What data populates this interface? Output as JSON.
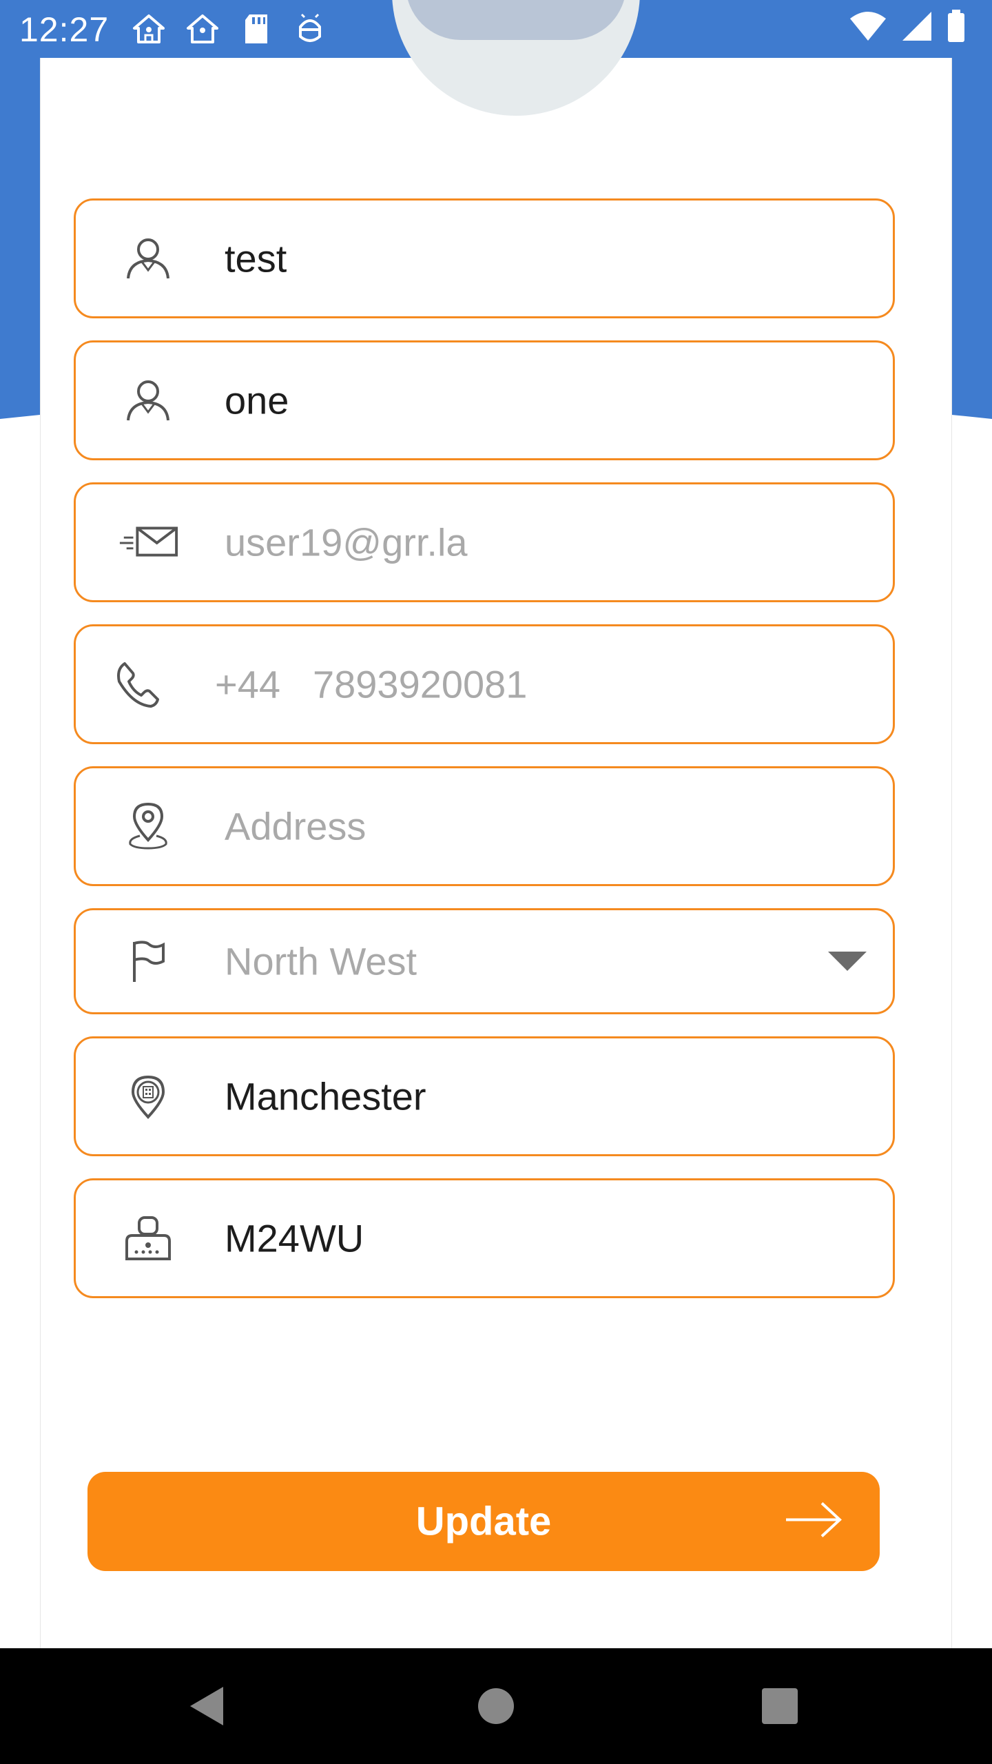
{
  "status_bar": {
    "time": "12:27",
    "left_icons": [
      "home-person-icon",
      "home-icon",
      "sd-card-icon",
      "android-debug-icon"
    ],
    "right_icons": [
      "wifi-icon",
      "cell-signal-icon",
      "battery-icon"
    ]
  },
  "form": {
    "first_name": {
      "value": "test",
      "icon": "person-icon"
    },
    "last_name": {
      "value": "one",
      "icon": "person-icon"
    },
    "email": {
      "value": "user19@grr.la",
      "icon": "mail-icon"
    },
    "phone": {
      "dial_code": "+44",
      "value": "7893920081",
      "icon": "phone-icon"
    },
    "address": {
      "placeholder": "Address",
      "icon": "location-pin-icon"
    },
    "region": {
      "selected": "North West",
      "icon": "flag-icon"
    },
    "city": {
      "value": "Manchester",
      "icon": "city-pin-icon"
    },
    "postcode": {
      "value": "M24WU",
      "icon": "mailbox-icon"
    }
  },
  "update_button": {
    "label": "Update",
    "icon": "arrow-right-icon"
  },
  "nav_bar": {
    "buttons": [
      "back-icon",
      "home-icon",
      "recents-icon"
    ]
  },
  "colors": {
    "header_blue": "#3f7bcf",
    "accent_orange": "#f58a1f",
    "button_orange": "#fb8a13",
    "placeholder_gray": "#a9a9a9"
  }
}
